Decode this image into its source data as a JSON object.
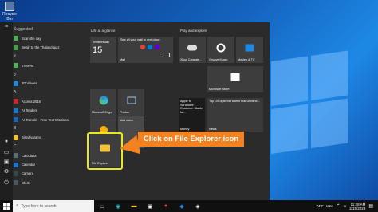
{
  "desktop": {
    "recycle_label": "Recycle Bin"
  },
  "start_menu": {
    "apps": [
      {
        "label": "Suggested",
        "icon": "section-letter"
      },
      {
        "label": "Scan the day",
        "icon": "suggested-app-icon",
        "color": "#4caf50"
      },
      {
        "label": "Begin to the Thaland quiz",
        "icon": "suggested-app-icon",
        "color": "#43a047"
      },
      {
        "label": "#",
        "icon": "section-letter"
      },
      {
        "label": "uTorrent",
        "icon": "utorrent-icon",
        "color": "#4caf50"
      },
      {
        "label": "3",
        "icon": "section-letter"
      },
      {
        "label": "3D Viewer",
        "icon": "3d-viewer-icon",
        "color": "#1e88e5"
      },
      {
        "label": "A",
        "icon": "section-letter"
      },
      {
        "label": "Access 2016",
        "icon": "access-icon",
        "color": "#c62828"
      },
      {
        "label": "AI Tenders",
        "icon": "ai-tenders-icon",
        "color": "#1976d2"
      },
      {
        "label": "AI Transkit - Free Text Windows",
        "icon": "ai-transkit-icon",
        "color": "#1565c0"
      },
      {
        "label": "B",
        "icon": "section-letter"
      },
      {
        "label": "Bjrsyllvaramo",
        "icon": "folder-icon",
        "color": "#fbc02d"
      },
      {
        "label": "C",
        "icon": "section-letter"
      },
      {
        "label": "Calculator",
        "icon": "calculator-icon",
        "color": "#546e7a"
      },
      {
        "label": "Calendar",
        "icon": "calendar-icon",
        "color": "#1976d2"
      },
      {
        "label": "Camera",
        "icon": "camera-icon",
        "color": "#37474f"
      },
      {
        "label": "Clock",
        "icon": "clock-icon",
        "color": "#455a64"
      }
    ],
    "groups": {
      "life": "Life at a glance",
      "play": "Play and explore"
    },
    "tiles": {
      "calendar_day": "Wednesday",
      "calendar_date": "15",
      "mail_text": "See all your mail in one place",
      "mail": "Mail",
      "edge": "Microsoft Edge",
      "photos": "Photos",
      "xbox": "Xbox Console...",
      "groove": "Groove Music",
      "movies": "Movies & TV",
      "store": "Microsoft Store",
      "weather": "Weather",
      "stickies": "Add notes",
      "news_text": "Apple to Scrutinize Customer Stable for...",
      "news_label": "Money",
      "news2_text": "Top US diplomat warns that Ukraine...",
      "news2_label": "News",
      "file_explorer": "File Explorer"
    }
  },
  "callout": "Click on File Explorer icon",
  "taskbar": {
    "search_placeholder": "Type here to search",
    "weather": "74°F Haze",
    "time": "11:28 AM",
    "date": "2/15/2023"
  }
}
